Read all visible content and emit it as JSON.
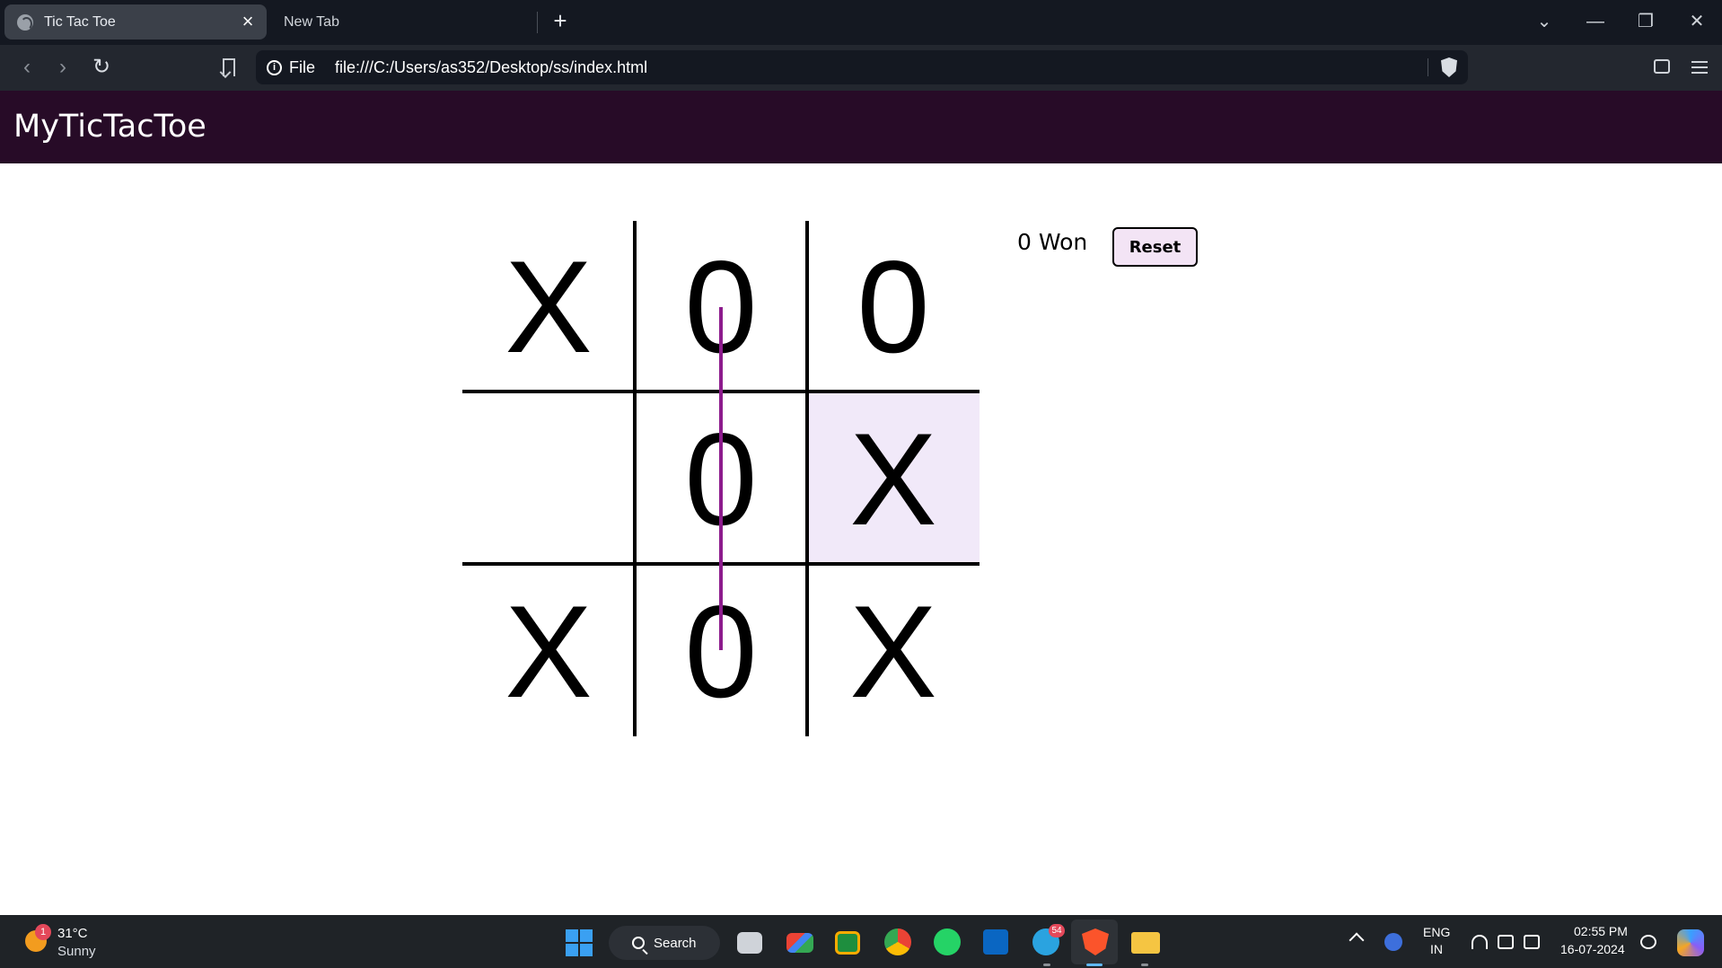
{
  "browser": {
    "active_tab_title": "Tic Tac Toe",
    "inactive_tab_title": "New Tab",
    "close_glyph": "×",
    "newtab_glyph": "+",
    "address_prefix": "File",
    "url": "file:///C:/Users/as352/Desktop/ss/index.html",
    "info_glyph": "i",
    "back_glyph": "‹",
    "forward_glyph": "›",
    "reload_glyph": "↻",
    "win_chevron": "⌄",
    "win_min": "—",
    "win_restore": "❐",
    "win_close": "✕"
  },
  "app": {
    "title": "MyTicTacToe",
    "board": [
      "X",
      "0",
      "0",
      "",
      "0",
      "X",
      "X",
      "0",
      "X"
    ],
    "highlight_cell_index": 5,
    "highlight_color": "#f1e9f9",
    "win_line_color": "#8d1c8d",
    "status_text": "0 Won",
    "reset_label": "Reset"
  },
  "taskbar": {
    "weather_badge": "1",
    "temperature": "31°C",
    "condition": "Sunny",
    "search_label": "Search",
    "telegram_badge": "54",
    "lang_top": "ENG",
    "lang_bottom": "IN",
    "time": "02:55 PM",
    "date": "16-07-2024",
    "apps": [
      "task-view",
      "gmail",
      "google-classroom",
      "chrome",
      "whatsapp",
      "linkedin",
      "telegram",
      "brave",
      "file-explorer"
    ]
  }
}
